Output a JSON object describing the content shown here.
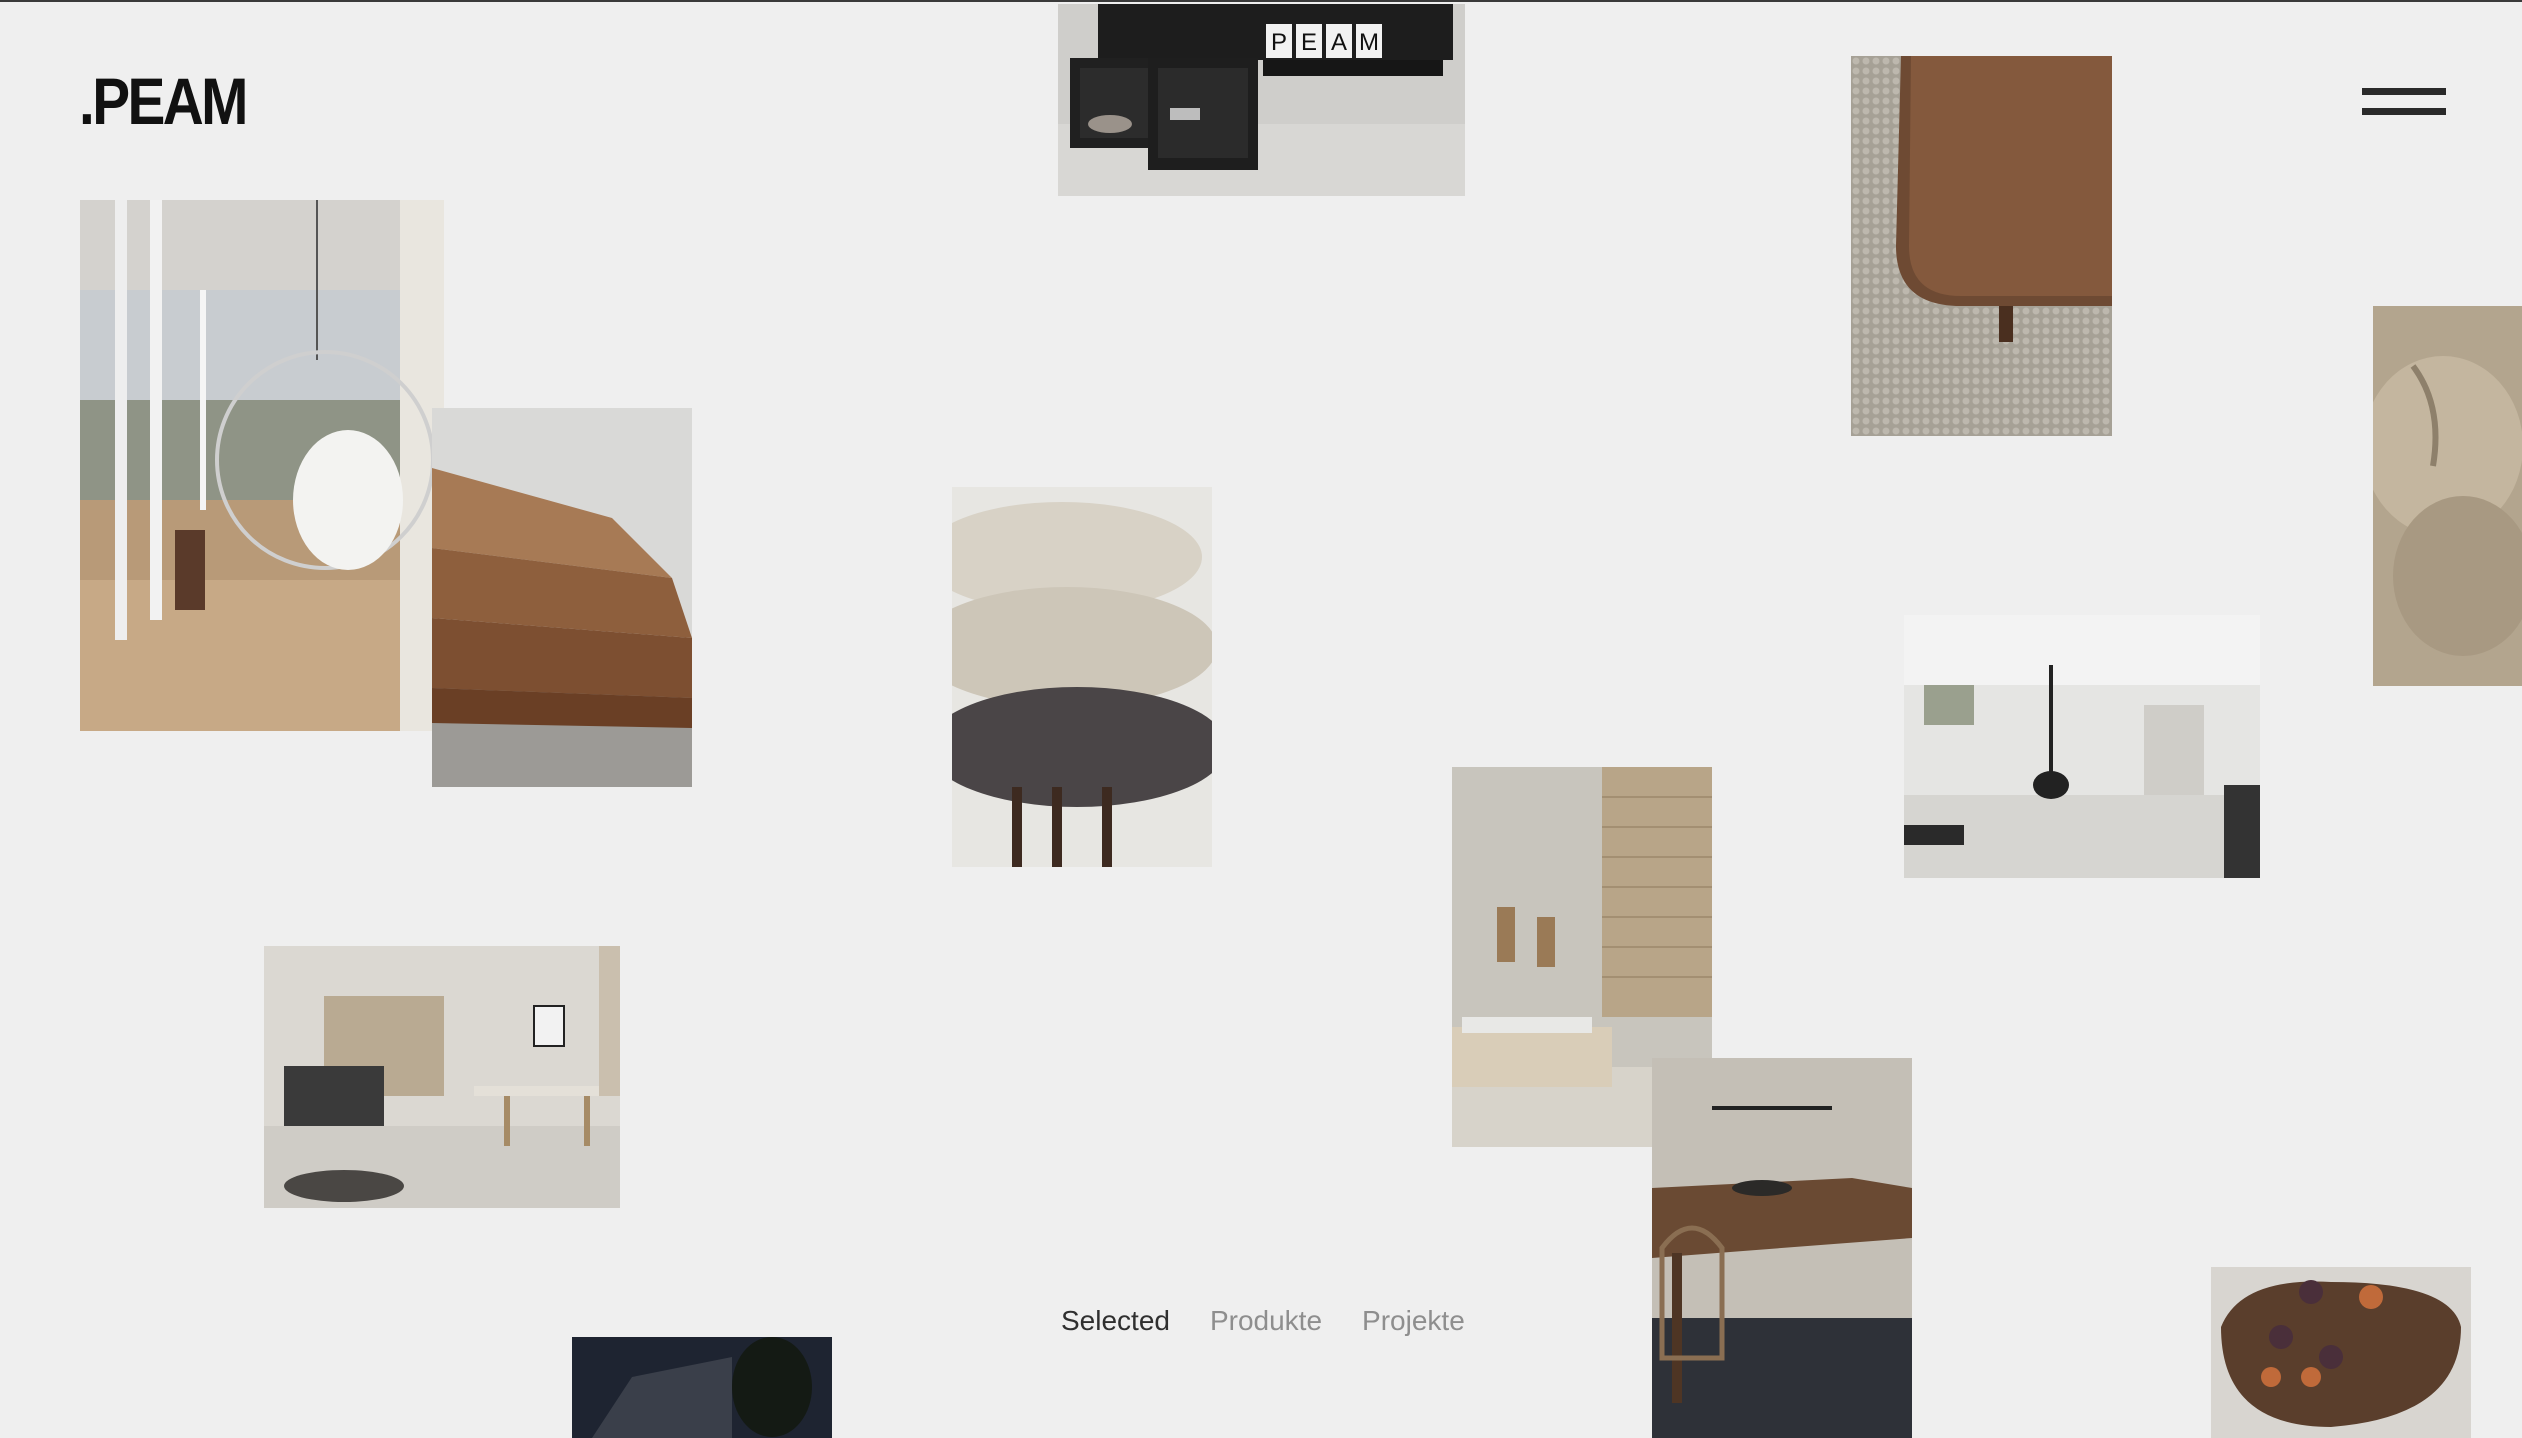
{
  "header": {
    "logo_text": ".PEAM",
    "menu_icon": "hamburger-icon"
  },
  "filters": [
    {
      "label": "Selected",
      "active": true
    },
    {
      "label": "Produkte",
      "active": false
    },
    {
      "label": "Projekte",
      "active": false
    }
  ],
  "shelf_lettering": [
    "P",
    "E",
    "A",
    "M"
  ],
  "colors": {
    "background": "#efefef",
    "text_dark": "#111111",
    "text_muted": "#8e8e8e"
  }
}
